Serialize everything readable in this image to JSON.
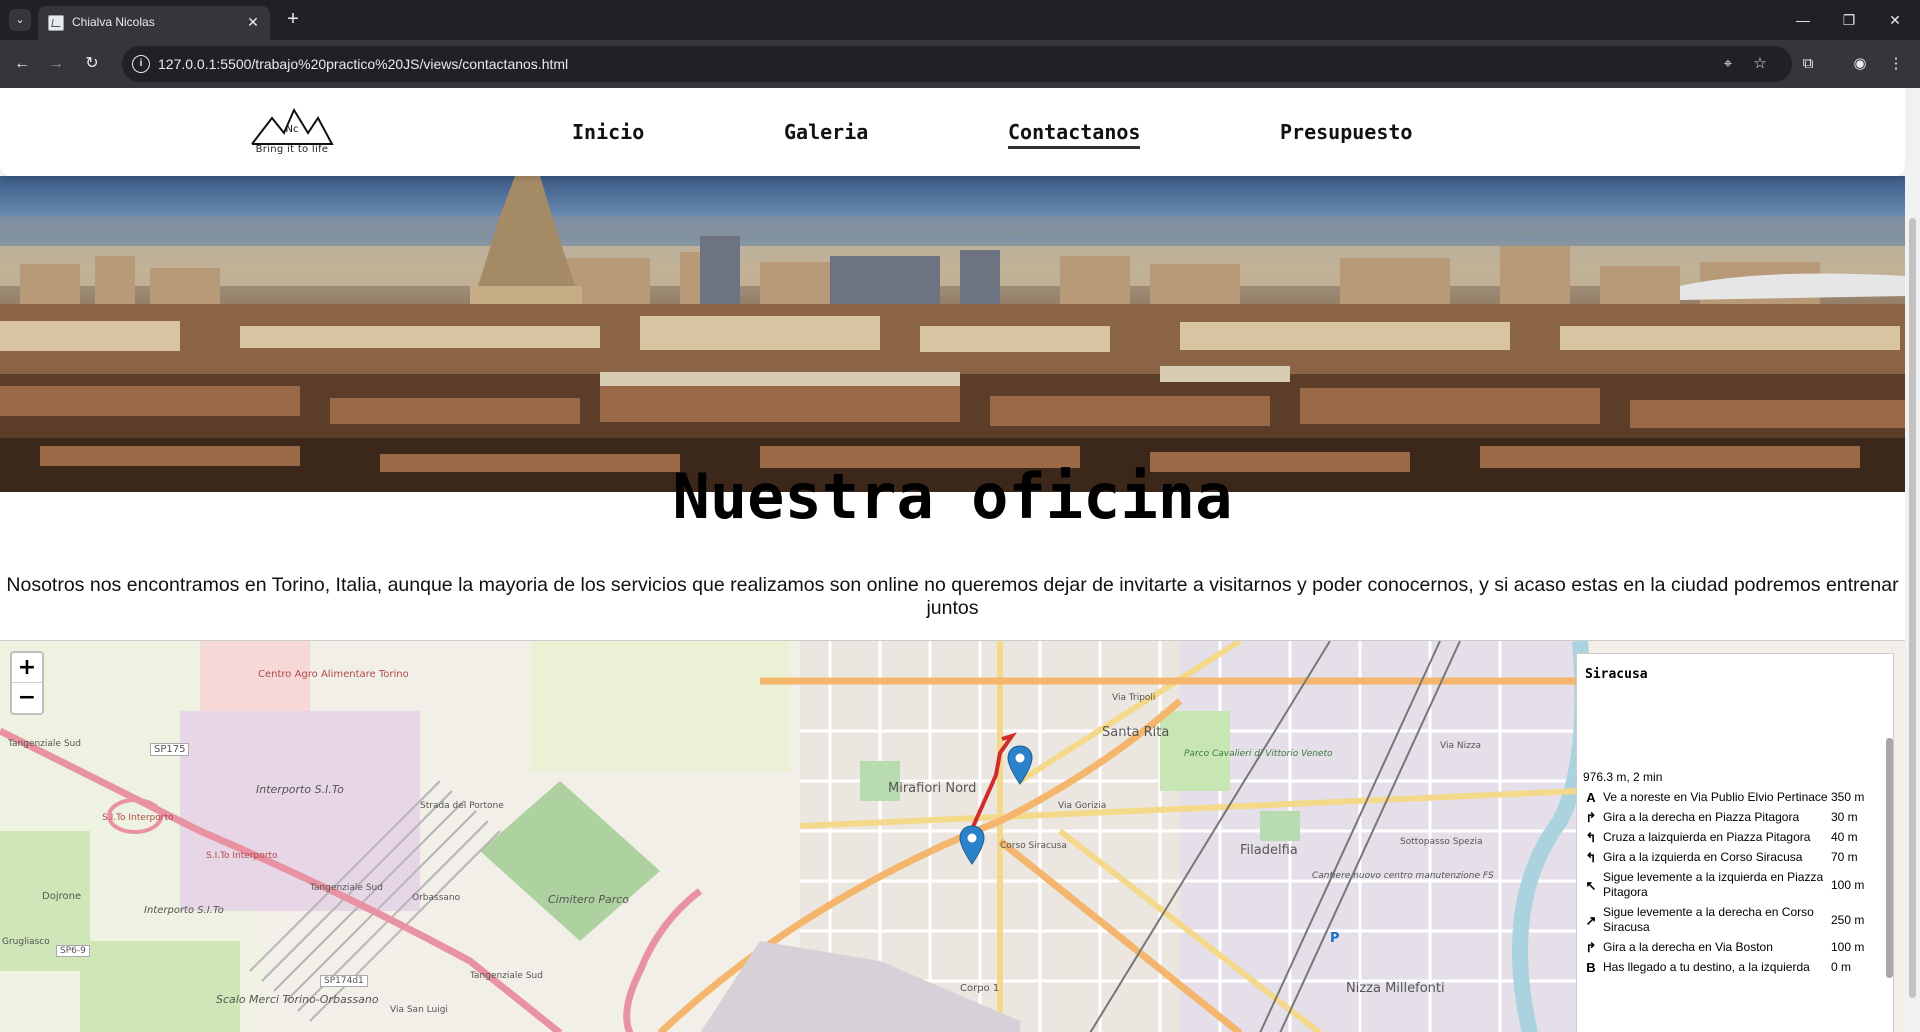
{
  "browser": {
    "tab_title": "Chialva Nicolas",
    "url": "127.0.0.1:5500/trabajo%20practico%20JS/views/contactanos.html",
    "icons": [
      "tab-search-icon",
      "close-icon",
      "new-tab-icon",
      "back-icon",
      "forward-icon",
      "reload-icon",
      "site-info-icon",
      "location-icon",
      "bookmark-star-icon",
      "extensions-icon",
      "profile-icon",
      "menu-icon",
      "minimize-icon",
      "restore-icon",
      "window-close-icon"
    ]
  },
  "header": {
    "logo_initials": "Nc",
    "logo_caption": "Bring it to life",
    "nav": [
      {
        "label": "Inicio"
      },
      {
        "label": "Galeria"
      },
      {
        "label": "Contactanos"
      },
      {
        "label": "Presupuesto"
      }
    ]
  },
  "content": {
    "title": "Nuestra oficina",
    "text": "Nosotros nos encontramos en Torino, Italia, aunque la mayoria de los servicios que realizamos son online no queremos dejar de invitarte a visitarnos y poder conocernos, y si acaso estas en la ciudad podremos entrenar juntos"
  },
  "map": {
    "zoom_in": "+",
    "zoom_out": "−",
    "labels": {
      "centro_agro": "Centro Agro Alimentare Torino",
      "sp175": "SP175",
      "interporto1": "Interporto S.I.To",
      "sito_interporto1": "S.I.To Interporto",
      "sito_interporto2": "S.I.To Interporto",
      "interporto2": "Interporto S.I.To",
      "tangenziale1": "Tangenziale Sud",
      "tangenziale2": "Tangenziale Sud",
      "tangenziale3": "Tangenziale Sud",
      "dojrone": "Dojrone",
      "grugliasco": "Grugliasco",
      "sp69": "SP6-9",
      "sp174": "SP174d1",
      "scalo": "Scalo Merci Torino-Orbassano",
      "cimitero": "Cimitero Parco",
      "orbassano": "Orbassano",
      "strada_portone": "Strada del Portone",
      "via_san_luigi": "Via San Luigi",
      "mirafiori": "Mirafiori Nord",
      "santa_rita": "Santa Rita",
      "parco_cavalieri": "Parco Cavalieri di Vittorio Veneto",
      "filadelfia": "Filadelfia",
      "nizza": "Nizza Millefonti",
      "corpo": "Corpo 1",
      "cantiere": "Cantiere nuovo centro manutenzione FS",
      "sottopasso": "Sottopasso Spezia",
      "corso_siracusa": "Corso Siracusa",
      "via_gorizia": "Via Gorizia",
      "via_tripoli": "Via Tripoli",
      "via_nizza": "Via Nizza",
      "parking": "P"
    },
    "route": {
      "destination": "Siracusa",
      "summary": "976.3 m, 2 min",
      "steps": [
        {
          "icon": "start-marker-icon",
          "glyph": "A",
          "text": "Ve a noreste en Via Publio Elvio Pertinace",
          "distance": "350 m"
        },
        {
          "icon": "turn-right-icon",
          "glyph": "↱",
          "text": "Gira a la derecha en Piazza Pitagora",
          "distance": "30 m"
        },
        {
          "icon": "turn-left-icon",
          "glyph": "↰",
          "text": "Cruza a laizquierda en Piazza Pitagora",
          "distance": "40 m"
        },
        {
          "icon": "turn-left-icon",
          "glyph": "↰",
          "text": "Gira a la izquierda en Corso Siracusa",
          "distance": "70 m"
        },
        {
          "icon": "slight-left-icon",
          "glyph": "↖",
          "text": "Sigue levemente a la izquierda en Piazza Pitagora",
          "distance": "100 m"
        },
        {
          "icon": "slight-right-icon",
          "glyph": "↗",
          "text": "Sigue levemente a la derecha en Corso Siracusa",
          "distance": "250 m"
        },
        {
          "icon": "turn-right-icon",
          "glyph": "↱",
          "text": "Gira a la derecha en Via Boston",
          "distance": "100 m"
        },
        {
          "icon": "end-marker-icon",
          "glyph": "B",
          "text": "Has llegado a tu destino, a la izquierda",
          "distance": "0 m"
        }
      ]
    }
  }
}
